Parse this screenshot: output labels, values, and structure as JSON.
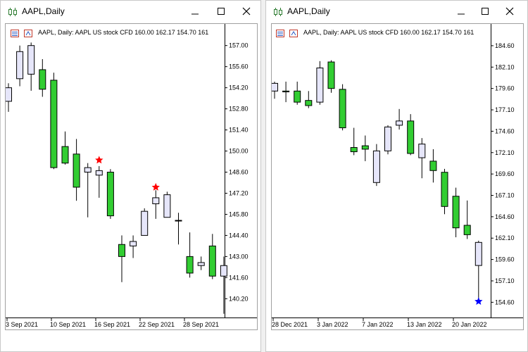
{
  "colors": {
    "bull": "#32cd32",
    "bear": "#e6e6fa",
    "wick": "#000000",
    "sep_marker": "#ff0000",
    "jan_marker": "#0000ff"
  },
  "windows": [
    {
      "title": "AAPL,Daily",
      "info": "AAPL, Daily:  AAPL US stock CFD   160.00  162.17  154.70  161",
      "buttons": {
        "minimize": "minimize-icon",
        "maximize": "maximize-icon",
        "close": "close-icon"
      }
    },
    {
      "title": "AAPL,Daily",
      "info": "AAPL, Daily:  AAPL US stock CFD   160.00  162.17  154.70  161",
      "buttons": {
        "minimize": "minimize-icon",
        "maximize": "maximize-icon",
        "close": "close-icon"
      }
    }
  ],
  "chart_data": [
    {
      "type": "candlestick",
      "symbol": "AAPL",
      "timeframe": "Daily",
      "ylim": [
        139.0,
        157.5
      ],
      "y_ticks": [
        "157.00",
        "155.60",
        "154.20",
        "152.80",
        "151.40",
        "150.00",
        "148.60",
        "147.20",
        "145.80",
        "144.40",
        "143.00",
        "141.60",
        "140.20"
      ],
      "x_tick_labels": [
        "3 Sep 2021",
        "10 Sep 2021",
        "16 Sep 2021",
        "22 Sep 2021",
        "28 Sep 2021"
      ],
      "candles": [
        {
          "o": 153.3,
          "h": 154.5,
          "l": 152.6,
          "c": 154.2
        },
        {
          "o": 154.8,
          "h": 157.0,
          "l": 154.3,
          "c": 156.6
        },
        {
          "o": 155.1,
          "h": 157.2,
          "l": 154.0,
          "c": 157.0
        },
        {
          "o": 155.4,
          "h": 156.1,
          "l": 153.6,
          "c": 154.1
        },
        {
          "o": 154.7,
          "h": 155.2,
          "l": 148.8,
          "c": 148.9
        },
        {
          "o": 150.3,
          "h": 151.3,
          "l": 149.1,
          "c": 149.2
        },
        {
          "o": 149.8,
          "h": 150.8,
          "l": 146.7,
          "c": 147.6
        },
        {
          "o": 148.6,
          "h": 149.2,
          "l": 145.6,
          "c": 148.9
        },
        {
          "o": 148.4,
          "h": 149.0,
          "l": 146.9,
          "c": 148.7
        },
        {
          "o": 148.6,
          "h": 148.8,
          "l": 145.5,
          "c": 145.7
        },
        {
          "o": 143.8,
          "h": 144.4,
          "l": 141.3,
          "c": 143.0
        },
        {
          "o": 143.7,
          "h": 144.4,
          "l": 142.9,
          "c": 144.0
        },
        {
          "o": 144.4,
          "h": 146.2,
          "l": 144.4,
          "c": 146.0
        },
        {
          "o": 146.5,
          "h": 147.4,
          "l": 145.5,
          "c": 146.9
        },
        {
          "o": 145.6,
          "h": 147.3,
          "l": 145.6,
          "c": 147.1
        },
        {
          "o": 145.4,
          "h": 145.9,
          "l": 143.8,
          "c": 145.4
        },
        {
          "o": 143.0,
          "h": 144.6,
          "l": 141.6,
          "c": 141.9
        },
        {
          "o": 142.4,
          "h": 143.0,
          "l": 142.1,
          "c": 142.6
        },
        {
          "o": 143.7,
          "h": 144.5,
          "l": 141.5,
          "c": 141.7
        },
        {
          "o": 141.7,
          "h": 143.0,
          "l": 139.2,
          "c": 142.4
        }
      ],
      "markers": [
        {
          "index": 8,
          "value": 149.4,
          "shape": "star",
          "color": "#ff0000"
        },
        {
          "index": 13,
          "value": 147.6,
          "shape": "star",
          "color": "#ff0000"
        }
      ]
    },
    {
      "type": "candlestick",
      "symbol": "AAPL",
      "timeframe": "Daily",
      "ylim": [
        152.9,
        185.5
      ],
      "y_ticks": [
        "184.60",
        "182.10",
        "179.60",
        "177.10",
        "174.60",
        "172.10",
        "169.60",
        "167.10",
        "164.60",
        "162.10",
        "159.60",
        "157.10",
        "154.60"
      ],
      "x_tick_labels": [
        "28 Dec 2021",
        "3 Jan 2022",
        "7 Jan 2022",
        "13 Jan 2022",
        "20 Jan 2022"
      ],
      "candles": [
        {
          "o": 179.3,
          "h": 180.4,
          "l": 178.4,
          "c": 180.2
        },
        {
          "o": 179.3,
          "h": 180.4,
          "l": 178.0,
          "c": 179.2
        },
        {
          "o": 179.3,
          "h": 180.4,
          "l": 177.7,
          "c": 178.0
        },
        {
          "o": 178.2,
          "h": 179.3,
          "l": 177.3,
          "c": 177.6
        },
        {
          "o": 178.0,
          "h": 182.8,
          "l": 177.7,
          "c": 182.0
        },
        {
          "o": 182.7,
          "h": 182.9,
          "l": 179.1,
          "c": 179.6
        },
        {
          "o": 179.5,
          "h": 180.1,
          "l": 174.7,
          "c": 175.0
        },
        {
          "o": 172.7,
          "h": 175.0,
          "l": 171.8,
          "c": 172.2
        },
        {
          "o": 172.9,
          "h": 174.1,
          "l": 171.1,
          "c": 172.5
        },
        {
          "o": 168.6,
          "h": 173.1,
          "l": 168.2,
          "c": 172.3
        },
        {
          "o": 172.3,
          "h": 175.3,
          "l": 171.9,
          "c": 175.1
        },
        {
          "o": 175.3,
          "h": 177.2,
          "l": 174.8,
          "c": 175.8
        },
        {
          "o": 175.8,
          "h": 176.6,
          "l": 171.8,
          "c": 172.0
        },
        {
          "o": 171.5,
          "h": 173.8,
          "l": 169.1,
          "c": 173.1
        },
        {
          "o": 171.1,
          "h": 172.5,
          "l": 168.6,
          "c": 170.0
        },
        {
          "o": 169.8,
          "h": 170.2,
          "l": 164.9,
          "c": 165.8
        },
        {
          "o": 167.0,
          "h": 168.0,
          "l": 162.2,
          "c": 163.3
        },
        {
          "o": 163.6,
          "h": 166.5,
          "l": 162.0,
          "c": 162.5
        },
        {
          "o": 158.9,
          "h": 161.8,
          "l": 154.8,
          "c": 161.6
        }
      ],
      "markers": [
        {
          "index": 18,
          "value": 154.7,
          "shape": "star",
          "color": "#0000ff"
        }
      ]
    }
  ]
}
